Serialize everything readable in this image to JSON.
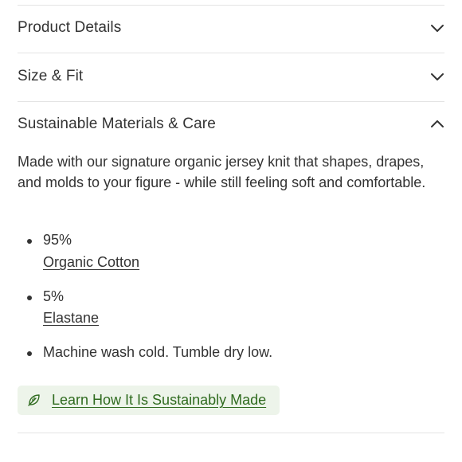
{
  "accordion": {
    "sections": [
      {
        "label": "Product Details",
        "expanded": false,
        "icon": "chevron-down-icon"
      },
      {
        "label": "Size & Fit",
        "expanded": false,
        "icon": "chevron-down-icon"
      },
      {
        "label": "Sustainable Materials & Care",
        "expanded": true,
        "icon": "chevron-up-icon"
      }
    ]
  },
  "materials": {
    "description": "Made with our signature organic jersey knit that shapes, drapes, and molds to your figure - while still feeling soft and comfortable.",
    "items": [
      {
        "percent": "95%",
        "material": "Organic Cotton"
      },
      {
        "percent": "5%",
        "material": "Elastane"
      }
    ],
    "care": "Machine wash cold. Tumble dry low."
  },
  "sustainability_link": {
    "label": "Learn How It Is Sustainably Made",
    "icon": "leaf-icon",
    "background": "#edf4ea",
    "text_color": "#2f6b1f"
  }
}
